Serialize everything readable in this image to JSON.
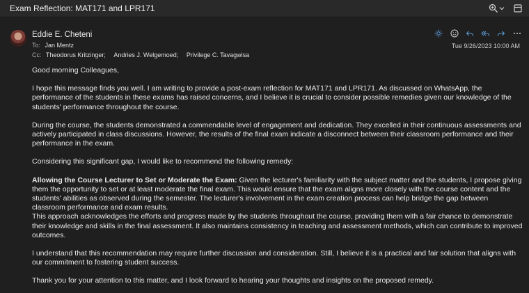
{
  "window": {
    "title": "Exam Reflection: MAT171 and LPR171",
    "icons": [
      "zoom-icon",
      "chevron-down-icon",
      "popout-icon"
    ]
  },
  "message": {
    "sender": "Eddie E. Cheteni",
    "to_label": "To:",
    "to": [
      "Jan Mentz"
    ],
    "cc_label": "Cc:",
    "cc": [
      "Theodorus Kritzinger;",
      "Andries J. Welgemoed;",
      "Privilege C. Tavagwisa"
    ],
    "date": "Tue 9/26/2023 10:00 AM",
    "actions": [
      "sun-icon",
      "smiley-icon",
      "reply-icon",
      "reply-all-icon",
      "forward-icon",
      "more-icon"
    ]
  },
  "body": {
    "greeting": "Good morning Colleagues,",
    "p1": "I hope this message finds you well. I am writing to provide a post-exam reflection for MAT171 and LPR171. As discussed on WhatsApp, the performance of the students in these exams has raised concerns, and I believe it is crucial to consider possible remedies given our knowledge of the students' performance throughout the course.",
    "p2": "During the course, the students demonstrated a commendable level of engagement and dedication. They excelled in their continuous assessments and actively participated in class discussions. However, the results of the final exam indicate a disconnect between their classroom performance and their performance in the exam.",
    "p3": "Considering this significant gap, I would like to recommend the following remedy:",
    "remedy_title": "Allowing the Course Lecturer to Set or Moderate the Exam:",
    "remedy_text": " Given the lecturer's familiarity with the subject matter and the students, I propose giving them the opportunity to set or at least moderate the final exam. This would ensure that the exam aligns more closely with the course content and the students' abilities as observed during the semester. The lecturer's involvement in the exam creation process can help bridge the gap between classroom performance and exam results.",
    "p4": "This approach acknowledges the efforts and progress made by the students throughout the course, providing them with a fair chance to demonstrate their knowledge and skills in the final assessment. It also maintains consistency in teaching and assessment methods, which can contribute to improved outcomes.",
    "p5": "I understand that this recommendation may require further discussion and consideration. Still, I believe it is a practical and fair solution that aligns with our commitment to fostering student success.",
    "p6": "Thank you for your attention to this matter, and I look forward to hearing your thoughts and insights on the proposed remedy."
  },
  "colors": {
    "background": "#1f1f1f",
    "titlebar": "#292929",
    "accent": "#5b9bd5",
    "text": "#e9e9e9"
  }
}
